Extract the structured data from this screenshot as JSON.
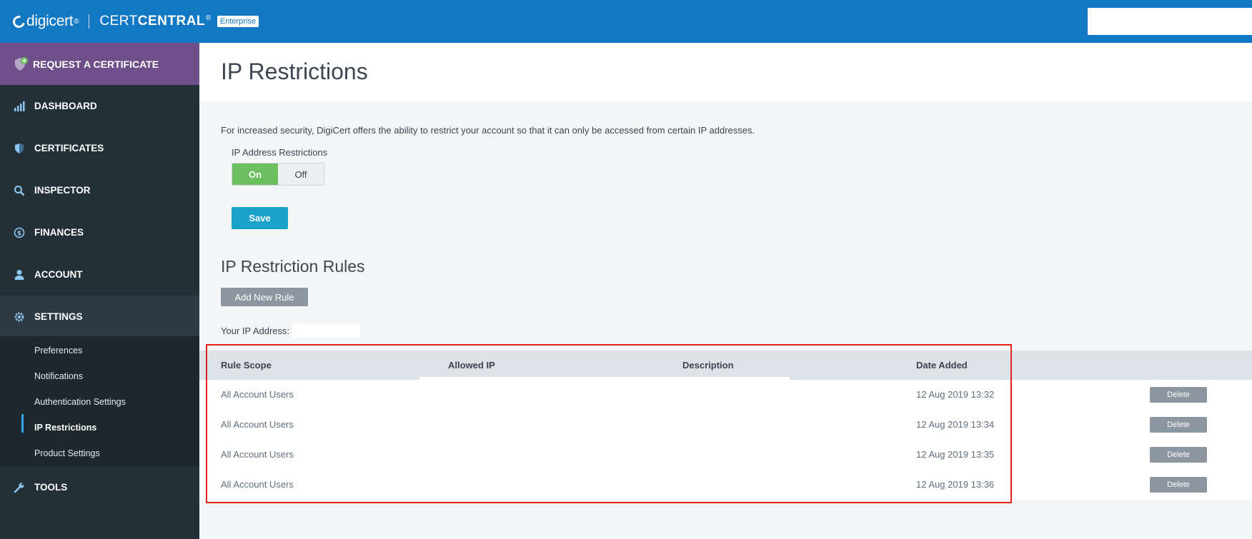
{
  "topbar": {
    "brand": "digicert",
    "reg": "®",
    "product_light": "CERT",
    "product_bold": "CENTRAL",
    "product_reg": "®",
    "badge": "Enterprise"
  },
  "sidebar": {
    "request": "REQUEST A CERTIFICATE",
    "items": [
      {
        "label": "DASHBOARD",
        "icon": "bar-chart-icon"
      },
      {
        "label": "CERTIFICATES",
        "icon": "shield-icon"
      },
      {
        "label": "INSPECTOR",
        "icon": "search-icon"
      },
      {
        "label": "FINANCES",
        "icon": "dollar-icon"
      },
      {
        "label": "ACCOUNT",
        "icon": "user-icon"
      },
      {
        "label": "SETTINGS",
        "icon": "gear-icon"
      },
      {
        "label": "TOOLS",
        "icon": "wrench-icon"
      }
    ],
    "settings_sub": [
      "Preferences",
      "Notifications",
      "Authentication Settings",
      "IP Restrictions",
      "Product Settings"
    ]
  },
  "main": {
    "title": "IP Restrictions",
    "intro": "For increased security, DigiCert offers the ability to restrict your account so that it can only be accessed from certain IP addresses.",
    "restrictions_label": "IP Address Restrictions",
    "toggle_on": "On",
    "toggle_off": "Off",
    "save": "Save",
    "rules_title": "IP Restriction Rules",
    "add_rule": "Add New Rule",
    "your_ip_label": "Your IP Address:",
    "table": {
      "headers": [
        "Rule Scope",
        "Allowed IP",
        "Description",
        "Date Added"
      ],
      "rows": [
        {
          "scope": "All Account Users",
          "date": "12 Aug 2019 13:32",
          "action": "Delete"
        },
        {
          "scope": "All Account Users",
          "date": "12 Aug 2019 13:34",
          "action": "Delete"
        },
        {
          "scope": "All Account Users",
          "date": "12 Aug 2019 13:35",
          "action": "Delete"
        },
        {
          "scope": "All Account Users",
          "date": "12 Aug 2019 13:36",
          "action": "Delete"
        }
      ]
    }
  },
  "colors": {
    "topbar": "#1378c3",
    "request": "#6f4f8a",
    "sidebar": "#233038",
    "on": "#6cbf5f",
    "save": "#1aa3c8",
    "highlight": "#e2231a"
  }
}
